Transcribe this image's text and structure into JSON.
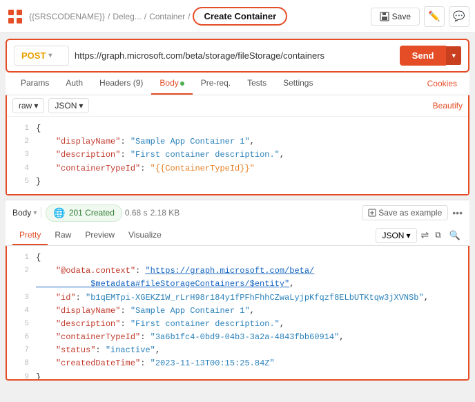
{
  "topBar": {
    "logo": "grid-icon",
    "breadcrumb": [
      "{{SRSCODENAME}}",
      "Deleg...",
      "Container"
    ],
    "activeTab": "Create Container",
    "saveLabel": "Save",
    "editIcon": "edit-icon",
    "commentIcon": "comment-icon"
  },
  "requestBar": {
    "method": "POST",
    "url": "https://graph.microsoft.com/beta/storage/fileStorage/containers",
    "sendLabel": "Send"
  },
  "requestTabs": {
    "tabs": [
      "Params",
      "Auth",
      "Headers (9)",
      "Body",
      "Pre-req.",
      "Tests",
      "Settings"
    ],
    "activeTab": "Body",
    "cookiesLabel": "Cookies"
  },
  "bodyEditor": {
    "formatOptions": [
      "raw",
      "JSON"
    ],
    "beautifyLabel": "Beautify",
    "lines": [
      {
        "num": 1,
        "content": "{"
      },
      {
        "num": 2,
        "content": "    \"displayName\": \"Sample App Container 1\","
      },
      {
        "num": 3,
        "content": "    \"description\": \"First container description.\","
      },
      {
        "num": 4,
        "content": "    \"containerTypeId\": \"{{ContainerTypeId}}\""
      },
      {
        "num": 5,
        "content": "}"
      }
    ]
  },
  "responseBar": {
    "label": "Body",
    "statusCode": "201 Created",
    "time": "0.68 s",
    "size": "2.18 KB",
    "saveExampleLabel": "Save as example",
    "moreIcon": "more-icon"
  },
  "responseTabs": {
    "tabs": [
      "Pretty",
      "Raw",
      "Preview",
      "Visualize"
    ],
    "activeTab": "Pretty",
    "format": "JSON",
    "filterIcon": "filter-icon",
    "copyIcon": "copy-icon",
    "searchIcon": "search-icon"
  },
  "responseBody": {
    "lines": [
      {
        "num": 1,
        "content": "{"
      },
      {
        "num": 2,
        "key": "@odata.context",
        "value": "https://graph.microsoft.com/beta/$metadata#fileStorageContainers/$entity",
        "isLink": true
      },
      {
        "num": 3,
        "key": "id",
        "value": "b1qEMTpi-XGEKZ1W_rLrH98r184y1fPFhFhhCZwaLyjpKfqzf8ELbUTKtqw3jXVNSb"
      },
      {
        "num": 4,
        "key": "displayName",
        "value": "Sample App Container 1"
      },
      {
        "num": 5,
        "key": "description",
        "value": "First container description."
      },
      {
        "num": 6,
        "key": "containerTypeId",
        "value": "3a6b1fc4-0bd9-04b3-3a2a-4843fbb60914"
      },
      {
        "num": 7,
        "key": "status",
        "value": "inactive"
      },
      {
        "num": 8,
        "key": "createdDateTime",
        "value": "2023-11-13T00:15:25.84Z"
      },
      {
        "num": 9,
        "content": "}"
      }
    ]
  }
}
